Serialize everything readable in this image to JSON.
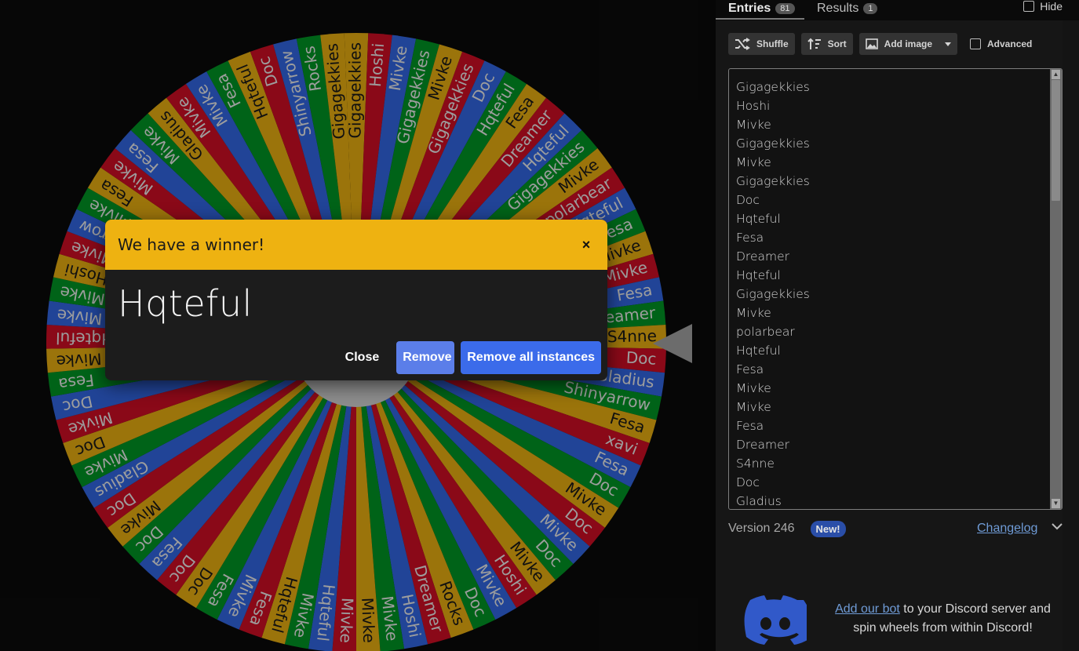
{
  "wheel": {
    "segments": [
      "Gigagekkies",
      "Hoshi",
      "Mivke",
      "Gigagekkies",
      "Mivke",
      "Gigagekkies",
      "Doc",
      "Hqteful",
      "Fesa",
      "Dreamer",
      "Hqteful",
      "Gigagekkies",
      "Mivke",
      "polarbear",
      "Hqteful",
      "Fesa",
      "Mivke",
      "Mivke",
      "Fesa",
      "Dreamer",
      "S4nne",
      "Doc",
      "Gladius",
      "Shinyarrow",
      "Fesa",
      "xavi",
      "Fesa",
      "Doc",
      "Mivke",
      "Doc",
      "Mivke",
      "Doc",
      "Mivke",
      "Hoshi",
      "Mivke",
      "Doc",
      "Rocks",
      "Dreamer",
      "Hoshi",
      "Mivke",
      "Mivke",
      "Mivke",
      "Hqteful",
      "Mivke",
      "Hqteful",
      "Fesa",
      "Mivke",
      "Fesa",
      "Doc",
      "Doc",
      "Fesa",
      "Doc",
      "Mivke",
      "Doc",
      "Gladius",
      "Mivke",
      "Doc",
      "Mivke",
      "Doc",
      "Fesa",
      "Mivke",
      "Hqteful",
      "Mivke",
      "Mivke",
      "Hoshi",
      "Mivke",
      "Shinyarrow",
      "Mivke",
      "Fesa",
      "Mivke",
      "Fesa",
      "Mivke",
      "Gladius",
      "Mivke",
      "Mivke",
      "Fesa",
      "Hqteful",
      "Doc",
      "Shinyarrow",
      "Rocks",
      "Gigagekkies"
    ],
    "colors": [
      "#eeb211",
      "#d50f25",
      "#3369e8",
      "#009925"
    ]
  },
  "dialog": {
    "title": "We have a winner!",
    "close_x": "×",
    "winner": "Hqteful",
    "close_label": "Close",
    "remove_label": "Remove",
    "remove_all_label": "Remove all instances"
  },
  "tabs": {
    "entries_label": "Entries",
    "entries_count": "81",
    "results_label": "Results",
    "results_count": "1",
    "hide_label": "Hide"
  },
  "toolbar": {
    "shuffle_label": "Shuffle",
    "sort_label": "Sort",
    "add_image_label": "Add image",
    "advanced_label": "Advanced"
  },
  "entries": [
    "Gigagekkies",
    "Hoshi",
    "Mivke",
    "Gigagekkies",
    "Mivke",
    "Gigagekkies",
    "Doc",
    "Hqteful",
    "Fesa",
    "Dreamer",
    "Hqteful",
    "Gigagekkies",
    "Mivke",
    "polarbear",
    "Hqteful",
    "Fesa",
    "Mivke",
    "Mivke",
    "Fesa",
    "Dreamer",
    "S4nne",
    "Doc",
    "Gladius"
  ],
  "footer": {
    "version": "Version 246",
    "new_badge": "New!",
    "changelog": "Changelog"
  },
  "discord": {
    "link_text": "Add our bot",
    "rest_text": " to your Discord server and spin wheels from within Discord!"
  }
}
